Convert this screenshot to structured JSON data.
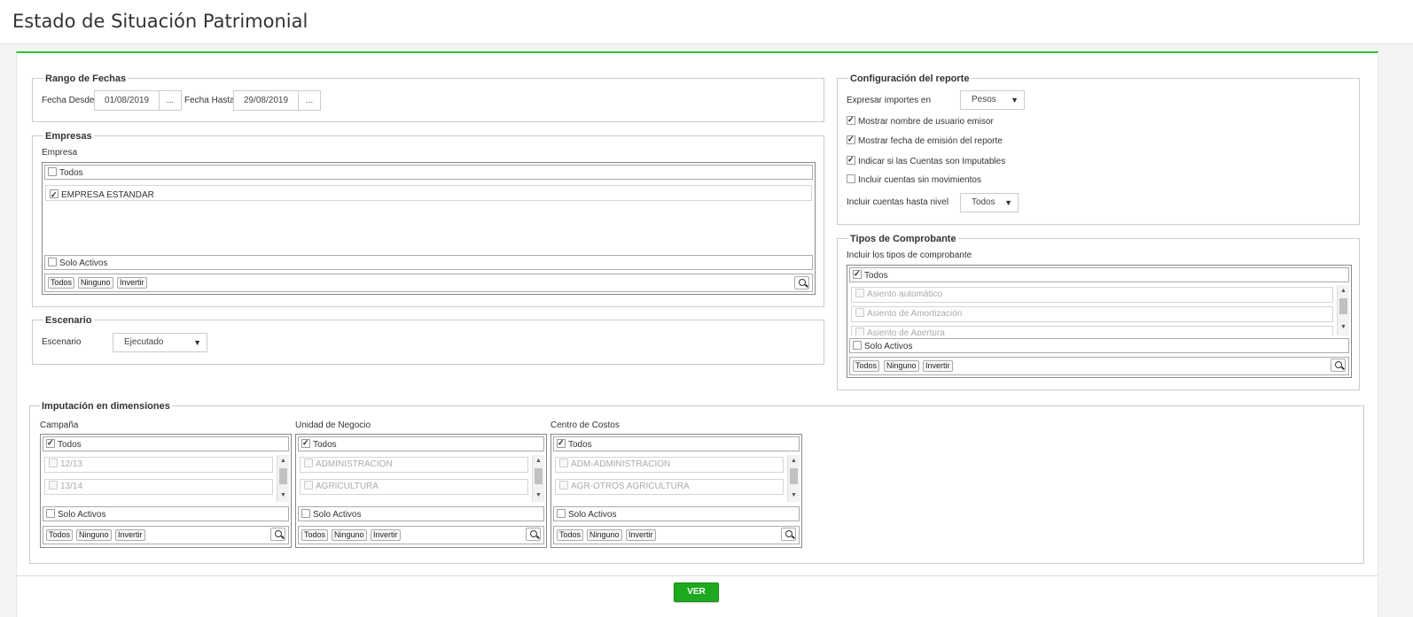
{
  "page": {
    "title": "Estado de Situación Patrimonial"
  },
  "rango": {
    "legend": "Rango de Fechas",
    "desde_label": "Fecha Desde",
    "desde_value": "01/08/2019",
    "hasta_label": "Fecha Hasta",
    "hasta_value": "29/08/2019",
    "picker": "..."
  },
  "empresas": {
    "legend": "Empresas",
    "label": "Empresa",
    "todos": "Todos",
    "items": [
      {
        "label": "EMPRESA ESTANDAR",
        "checked": true
      }
    ],
    "solo_activos": "Solo Activos",
    "btn_todos": "Todos",
    "btn_ninguno": "Ninguno",
    "btn_invertir": "Invertir"
  },
  "escenario": {
    "legend": "Escenario",
    "label": "Escenario",
    "value": "Ejecutado",
    "arrow": "▼"
  },
  "config": {
    "legend": "Configuración del reporte",
    "expresar_label": "Expresar importes en",
    "expresar_value": "Pesos",
    "opts": [
      {
        "label": "Mostrar nombre de usuario emisor",
        "checked": true
      },
      {
        "label": "Mostrar fecha de emisión del reporte",
        "checked": true
      },
      {
        "label": "Indicar si las Cuentas son Imputables",
        "checked": true
      },
      {
        "label": "Incluir cuentas sin movimientos",
        "checked": false
      }
    ],
    "nivel_label": "Incluir cuentas hasta nivel",
    "nivel_value": "Todos",
    "arrow": "▼"
  },
  "tipos": {
    "legend": "Tipos de Comprobante",
    "label": "Incluir los tipos de comprobante",
    "todos": "Todos",
    "items": [
      "Asiento automático",
      "Asiento de Amortización",
      "Asiento de Apertura"
    ],
    "solo_activos": "Solo Activos",
    "btn_todos": "Todos",
    "btn_ninguno": "Ninguno",
    "btn_invertir": "Invertir"
  },
  "imputacion": {
    "legend": "Imputación en dimensiones",
    "cols": [
      {
        "label": "Campaña",
        "todos": "Todos",
        "items": [
          "12/13",
          "13/14"
        ],
        "solo_activos": "Solo Activos",
        "btn_todos": "Todos",
        "btn_ninguno": "Ninguno",
        "btn_invertir": "Invertir"
      },
      {
        "label": "Unidad de Negocio",
        "todos": "Todos",
        "items": [
          "ADMINISTRACION",
          "AGRICULTURA"
        ],
        "solo_activos": "Solo Activos",
        "btn_todos": "Todos",
        "btn_ninguno": "Ninguno",
        "btn_invertir": "Invertir"
      },
      {
        "label": "Centro de Costos",
        "todos": "Todos",
        "items": [
          "ADM-ADMINISTRACION",
          "AGR-OTROS AGRICULTURA"
        ],
        "solo_activos": "Solo Activos",
        "btn_todos": "Todos",
        "btn_ninguno": "Ninguno",
        "btn_invertir": "Invertir"
      }
    ]
  },
  "footer": {
    "ver_label": "VER"
  },
  "colors": {
    "accent": "#29c529",
    "button": "#1eaa1e"
  },
  "icons": {
    "search": "magnifier-icon",
    "dropdown": "caret-down-icon",
    "checkbox": "checkbox-icon"
  }
}
